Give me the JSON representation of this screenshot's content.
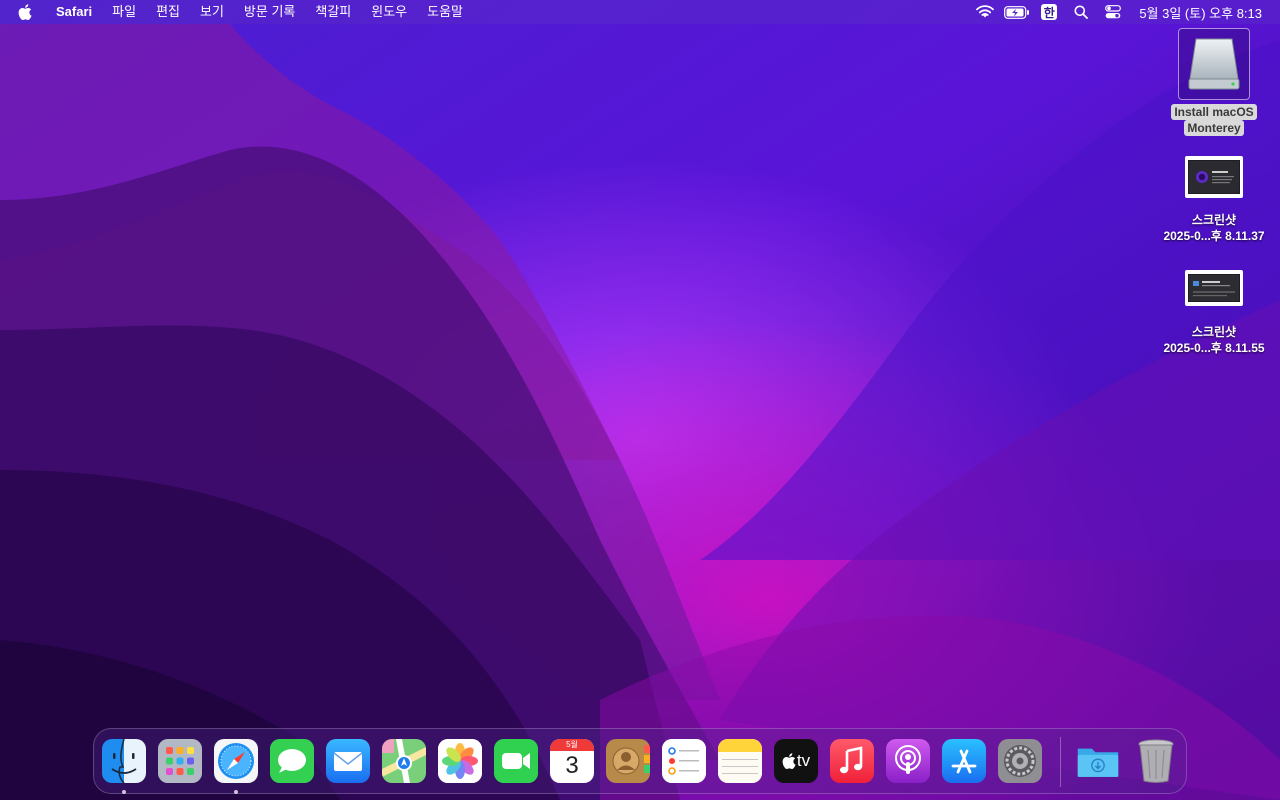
{
  "menubar": {
    "apple_icon": "apple-logo-icon",
    "app_name": "Safari",
    "menus": [
      "파일",
      "편집",
      "보기",
      "방문 기록",
      "책갈피",
      "윈도우",
      "도움말"
    ],
    "status_icons": [
      "wifi-icon",
      "battery-charging-icon",
      "input-source-icon",
      "spotlight-search-icon",
      "control-center-icon"
    ],
    "input_source": "한",
    "clock": "5월 3일 (토) 오후  8:13"
  },
  "desktop": {
    "items": [
      {
        "label_line1": "Install macOS",
        "label_line2": "Monterey",
        "icon": "external-drive-icon",
        "selected": true
      },
      {
        "label_line1": "스크린샷",
        "label_line2": "2025-0...후 8.11.37",
        "icon": "screenshot-thumbnail-icon",
        "selected": false
      },
      {
        "label_line1": "스크린샷",
        "label_line2": "2025-0...후 8.11.55",
        "icon": "screenshot-thumbnail-icon",
        "selected": false
      }
    ]
  },
  "dock": {
    "apps": [
      {
        "name": "Finder",
        "icon": "finder-icon",
        "running": true
      },
      {
        "name": "Launchpad",
        "icon": "launchpad-icon",
        "running": false
      },
      {
        "name": "Safari",
        "icon": "safari-icon",
        "running": true
      },
      {
        "name": "Messages",
        "icon": "messages-icon",
        "running": false
      },
      {
        "name": "Mail",
        "icon": "mail-icon",
        "running": false
      },
      {
        "name": "Maps",
        "icon": "maps-icon",
        "running": false
      },
      {
        "name": "Photos",
        "icon": "photos-icon",
        "running": false
      },
      {
        "name": "FaceTime",
        "icon": "facetime-icon",
        "running": false
      },
      {
        "name": "Calendar",
        "icon": "calendar-icon",
        "running": false
      },
      {
        "name": "Contacts",
        "icon": "contacts-icon",
        "running": false
      },
      {
        "name": "Reminders",
        "icon": "reminders-icon",
        "running": false
      },
      {
        "name": "Notes",
        "icon": "notes-icon",
        "running": false
      },
      {
        "name": "TV",
        "icon": "apple-tv-icon",
        "running": false
      },
      {
        "name": "Music",
        "icon": "music-icon",
        "running": false
      },
      {
        "name": "Podcasts",
        "icon": "podcasts-icon",
        "running": false
      },
      {
        "name": "App Store",
        "icon": "app-store-icon",
        "running": false
      },
      {
        "name": "System Preferences",
        "icon": "system-preferences-icon",
        "running": false
      },
      {
        "name": "Downloads",
        "icon": "downloads-folder-icon",
        "running": false
      },
      {
        "name": "Trash",
        "icon": "trash-icon",
        "running": false
      }
    ],
    "calendar_month": "5월",
    "calendar_day": "3",
    "tv_label": "tv"
  },
  "colors": {
    "menubar": "#5a28c8",
    "wallpaper_dark": "#2a0a60",
    "wallpaper_bright": "#8a2be2",
    "wallpaper_magenta": "#b010b0"
  }
}
